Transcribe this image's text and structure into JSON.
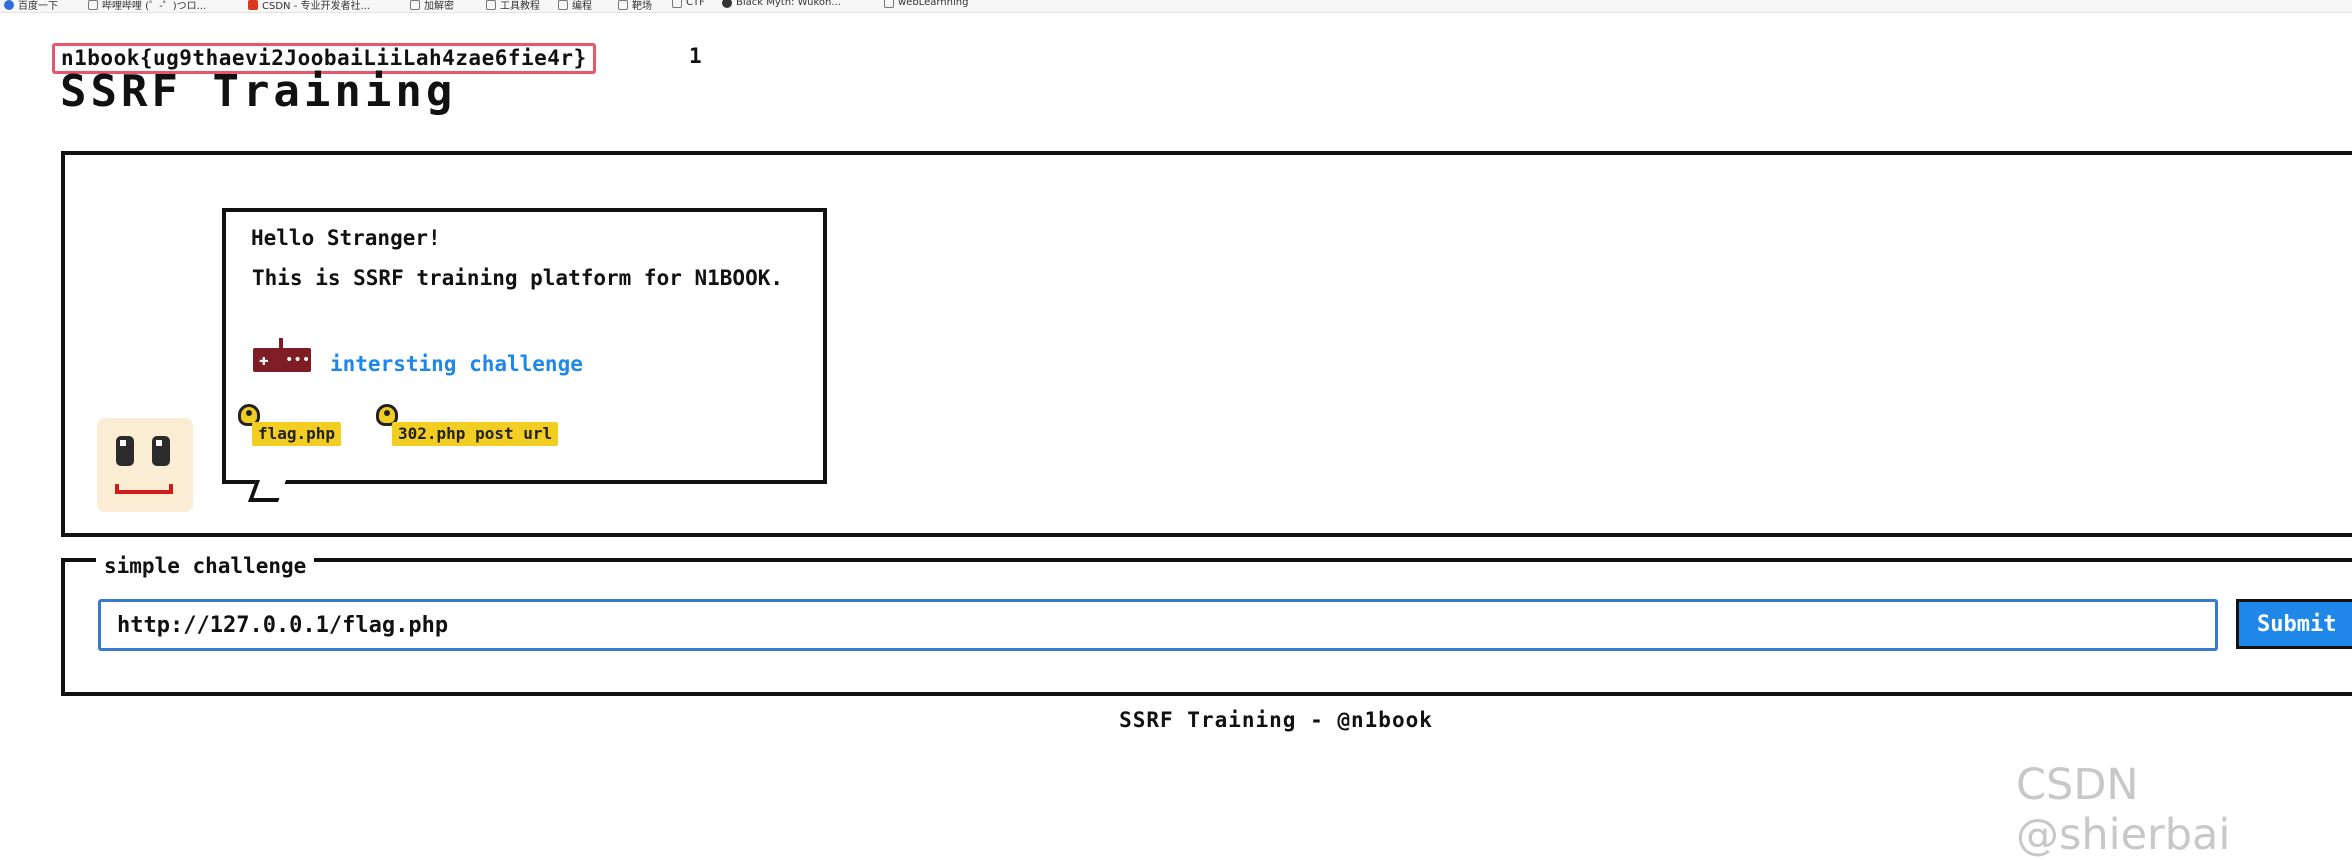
{
  "bookmarks": [
    "百度一下",
    "哔哩哔哩 (゜-゜)つロ...",
    "CSDN - 专业开发者社...",
    "加解密",
    "工具教程",
    "编程",
    "靶场",
    "CTF",
    "Black Myth: Wukon...",
    "webLearnning"
  ],
  "flag": "n1book{ug9thaevi2JoobaiLiiLah4zae6fie4r}",
  "flag_suffix": "1",
  "title": "SSRF Training",
  "bubble": {
    "greeting": "Hello Stranger!",
    "intro": "This is SSRF training platform for N1BOOK.",
    "challenge_link": "intersting challenge",
    "tags": [
      "flag.php",
      "302.php post url"
    ]
  },
  "form": {
    "legend": "simple challenge",
    "url_value": "http://127.0.0.1/flag.php",
    "submit_label": "Submit"
  },
  "footer": "SSRF Training - @n1book",
  "watermark": "CSDN @shierbai",
  "colors": {
    "flag_highlight": "#e8566a",
    "link": "#1e87e8",
    "tag": "#f2cd22",
    "button": "#1e87e8",
    "input_border": "#3b78d0"
  }
}
